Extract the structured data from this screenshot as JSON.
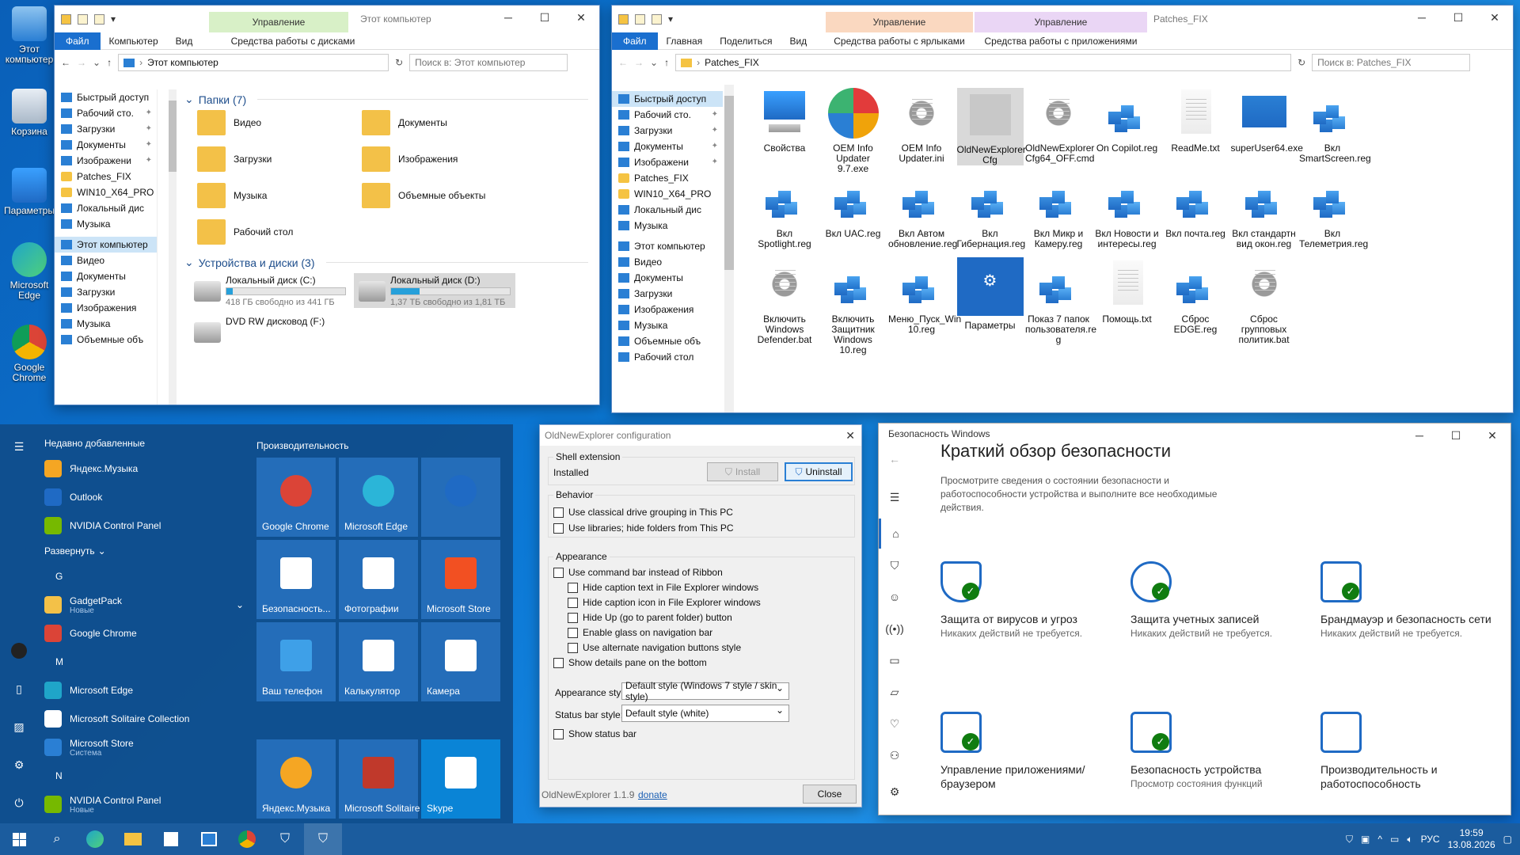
{
  "desktop": {
    "icons": [
      "Этот компьютер",
      "Корзина",
      "Параметры",
      "Microsoft Edge",
      "Google Chrome"
    ]
  },
  "explorer1": {
    "title": "Этот компьютер",
    "context_tab": "Управление",
    "ribbon": [
      "Файл",
      "Компьютер",
      "Вид",
      "Средства работы с дисками"
    ],
    "address": "Этот компьютер",
    "search_placeholder": "Поиск в: Этот компьютер",
    "nav": [
      {
        "label": "Быстрый доступ",
        "pin": false,
        "sel": false
      },
      {
        "label": "Рабочий сто.",
        "pin": true,
        "sel": false
      },
      {
        "label": "Загрузки",
        "pin": true,
        "sel": false
      },
      {
        "label": "Документы",
        "pin": true,
        "sel": false
      },
      {
        "label": "Изображени",
        "pin": true,
        "sel": false
      },
      {
        "label": "Patches_FIX",
        "pin": false,
        "sel": false
      },
      {
        "label": "WIN10_X64_PRO",
        "pin": false,
        "sel": false
      },
      {
        "label": "Локальный дис",
        "pin": false,
        "sel": false
      },
      {
        "label": "Музыка",
        "pin": false,
        "sel": false
      },
      {
        "label": "Этот компьютер",
        "pin": false,
        "sel": true
      },
      {
        "label": "Видео",
        "pin": false,
        "sel": false
      },
      {
        "label": "Документы",
        "pin": false,
        "sel": false
      },
      {
        "label": "Загрузки",
        "pin": false,
        "sel": false
      },
      {
        "label": "Изображения",
        "pin": false,
        "sel": false
      },
      {
        "label": "Музыка",
        "pin": false,
        "sel": false
      },
      {
        "label": "Объемные объ",
        "pin": false,
        "sel": false
      }
    ],
    "folders_header": "Папки (7)",
    "folders": [
      "Видео",
      "Документы",
      "Загрузки",
      "Изображения",
      "Музыка",
      "Объемные объекты",
      "Рабочий стол"
    ],
    "devices_header": "Устройства и диски (3)",
    "drives": [
      {
        "name": "Локальный диск (C:)",
        "free": "418 ГБ свободно из 441 ГБ",
        "used": 0.05
      },
      {
        "name": "Локальный диск (D:)",
        "free": "1,37 ТБ свободно из 1,81 ТБ",
        "used": 0.24
      },
      {
        "name": "DVD RW дисковод (F:)",
        "free": "",
        "used": 0
      }
    ]
  },
  "explorer2": {
    "title": "Patches_FIX",
    "context_tabs": [
      "Управление",
      "Управление"
    ],
    "ribbon": [
      "Файл",
      "Главная",
      "Поделиться",
      "Вид",
      "Средства работы с ярлыками",
      "Средства работы с приложениями"
    ],
    "address": "Patches_FIX",
    "search_placeholder": "Поиск в: Patches_FIX",
    "nav": [
      {
        "label": "Быстрый доступ",
        "pin": false,
        "sel": true
      },
      {
        "label": "Рабочий сто.",
        "pin": true,
        "sel": false
      },
      {
        "label": "Загрузки",
        "pin": true,
        "sel": false
      },
      {
        "label": "Документы",
        "pin": true,
        "sel": false
      },
      {
        "label": "Изображени",
        "pin": true,
        "sel": false
      },
      {
        "label": "Patches_FIX",
        "pin": false,
        "sel": false
      },
      {
        "label": "WIN10_X64_PRO",
        "pin": false,
        "sel": false
      },
      {
        "label": "Локальный дис",
        "pin": false,
        "sel": false
      },
      {
        "label": "Музыка",
        "pin": false,
        "sel": false
      },
      {
        "label": "Этот компьютер",
        "pin": false,
        "sel": false
      },
      {
        "label": "Видео",
        "pin": false,
        "sel": false
      },
      {
        "label": "Документы",
        "pin": false,
        "sel": false
      },
      {
        "label": "Загрузки",
        "pin": false,
        "sel": false
      },
      {
        "label": "Изображения",
        "pin": false,
        "sel": false
      },
      {
        "label": "Музыка",
        "pin": false,
        "sel": false
      },
      {
        "label": "Объемные объ",
        "pin": false,
        "sel": false
      },
      {
        "label": "Рабочий стол",
        "pin": false,
        "sel": false
      }
    ],
    "files": [
      {
        "label": "Свойства",
        "kind": "pc"
      },
      {
        "label": "OEM Info Updater 9.7.exe",
        "kind": "oem"
      },
      {
        "label": "OEM Info Updater.ini",
        "kind": "ini"
      },
      {
        "label": "OldNewExplorer Cfg",
        "kind": "shield"
      },
      {
        "label": "OldNewExplorer Cfg64_OFF.cmd",
        "kind": "cmd"
      },
      {
        "label": "On Copilot.reg",
        "kind": "reg"
      },
      {
        "label": "ReadMe.txt",
        "kind": "txt"
      },
      {
        "label": "superUser64.exe",
        "kind": "su"
      },
      {
        "label": "Вкл SmartScreen.reg",
        "kind": "reg"
      },
      {
        "label": "Вкл Spotlight.reg",
        "kind": "reg"
      },
      {
        "label": "Вкл UAC.reg",
        "kind": "reg"
      },
      {
        "label": "Вкл Автом обновление.reg",
        "kind": "reg"
      },
      {
        "label": "Вкл Гибернация.reg",
        "kind": "reg"
      },
      {
        "label": "Вкл Микр и Камеру.reg",
        "kind": "reg"
      },
      {
        "label": "Вкл Новости и интересы.reg",
        "kind": "reg"
      },
      {
        "label": "Вкл почта.reg",
        "kind": "reg"
      },
      {
        "label": "Вкл стандартн вид окон.reg",
        "kind": "reg"
      },
      {
        "label": "Вкл Телеметрия.reg",
        "kind": "reg"
      },
      {
        "label": "Включить Windows Defender.bat",
        "kind": "bat"
      },
      {
        "label": "Включить Защитник Windows 10.reg",
        "kind": "reg"
      },
      {
        "label": "Меню_Пуск_Win 10.reg",
        "kind": "reg"
      },
      {
        "label": "Параметры",
        "kind": "settings"
      },
      {
        "label": "Показ 7 папок пользователя.re g",
        "kind": "reg"
      },
      {
        "label": "Помощь.txt",
        "kind": "txt"
      },
      {
        "label": "Сброс EDGE.reg",
        "kind": "reg"
      },
      {
        "label": "Сброс групповых политик.bat",
        "kind": "bat"
      }
    ]
  },
  "start": {
    "recent_header": "Недавно добавленные",
    "productivity_header": "Производительность",
    "expand_label": "Развернуть",
    "list": [
      {
        "type": "app",
        "label": "Яндекс.Музыка",
        "sub": "",
        "color": "#f5a623"
      },
      {
        "type": "app",
        "label": "Outlook",
        "sub": "",
        "color": "#1f6ac4"
      },
      {
        "type": "app",
        "label": "NVIDIA Control Panel",
        "sub": "",
        "color": "#76b900"
      },
      {
        "type": "expand"
      },
      {
        "type": "letter",
        "label": "G"
      },
      {
        "type": "app",
        "label": "GadgetPack",
        "sub": "Новые",
        "color": "#f3c148"
      },
      {
        "type": "app",
        "label": "Google Chrome",
        "sub": "",
        "color": "#db4437"
      },
      {
        "type": "letter",
        "label": "M"
      },
      {
        "type": "app",
        "label": "Microsoft Edge",
        "sub": "",
        "color": "#1fa5c9"
      },
      {
        "type": "app",
        "label": "Microsoft Solitaire Collection",
        "sub": "",
        "color": "#ffffff"
      },
      {
        "type": "app",
        "label": "Microsoft Store",
        "sub": "Система",
        "color": "#2a7fd4"
      },
      {
        "type": "letter",
        "label": "N"
      },
      {
        "type": "app",
        "label": "NVIDIA Control Panel",
        "sub": "Новые",
        "color": "#76b900"
      }
    ],
    "tiles": [
      {
        "label": "Google Chrome",
        "color": "#db4437"
      },
      {
        "label": "Microsoft Edge",
        "color": "#2bb5d8"
      },
      {
        "label": "",
        "color": "#1f6ac4"
      },
      {
        "label": "Безопасность...",
        "color": "#ffffff"
      },
      {
        "label": "Фотографии",
        "color": "#ffffff"
      },
      {
        "label": "Microsoft Store",
        "color": "#f25022"
      },
      {
        "label": "Ваш телефон",
        "color": "#3ea0e8"
      },
      {
        "label": "Калькулятор",
        "color": "#ffffff"
      },
      {
        "label": "Камера",
        "color": "#ffffff"
      },
      {
        "label": "Яндекс.Музыка",
        "color": "#f5a623"
      },
      {
        "label": "Microsoft Solitaire Collection",
        "color": "#c0392b"
      },
      {
        "label": "Skype",
        "color": "#ffffff"
      }
    ]
  },
  "dialog": {
    "title": "OldNewExplorer configuration",
    "shell_group": "Shell extension",
    "status": "Installed",
    "install": "Install",
    "uninstall": "Uninstall",
    "behavior_group": "Behavior",
    "behavior": [
      "Use classical drive grouping in This PC",
      "Use libraries; hide folders from This PC"
    ],
    "appearance_group": "Appearance",
    "appearance": [
      {
        "label": "Use command bar instead of Ribbon",
        "indent": false
      },
      {
        "label": "Hide caption text in File Explorer windows",
        "indent": true
      },
      {
        "label": "Hide caption icon in File Explorer windows",
        "indent": true
      },
      {
        "label": "Hide Up (go to parent folder) button",
        "indent": true
      },
      {
        "label": "Enable glass on navigation bar",
        "indent": true
      },
      {
        "label": "Use alternate navigation buttons style",
        "indent": true
      },
      {
        "label": "Show details pane on the bottom",
        "indent": false
      }
    ],
    "appearance_style_label": "Appearance style:",
    "appearance_style_value": "Default style (Windows 7 style / skin style)",
    "status_bar_label": "Status bar style:",
    "status_bar_value": "Default style (white)",
    "show_status_bar": "Show status bar",
    "version": "OldNewExplorer 1.1.9",
    "donate": "donate",
    "close": "Close"
  },
  "security": {
    "title": "Безопасность Windows",
    "heading": "Краткий обзор безопасности",
    "desc": "Просмотрите сведения о состоянии безопасности и работоспособности устройства и выполните все необходимые действия.",
    "cards": [
      {
        "title": "Защита от вирусов и угроз",
        "sub": "Никаких действий не требуется.",
        "icon": "shield-icon"
      },
      {
        "title": "Защита учетных записей",
        "sub": "Никаких действий не требуется.",
        "icon": "account-icon"
      },
      {
        "title": "Брандмауэр и безопасность сети",
        "sub": "Никаких действий не требуется.",
        "icon": "antenna-icon"
      },
      {
        "title": "Управление приложениями/браузером",
        "sub": "",
        "icon": "app-browser-icon"
      },
      {
        "title": "Безопасность устройства",
        "sub": "Просмотр состояния функций",
        "icon": "laptop-icon"
      },
      {
        "title": "Производительность и работоспособность",
        "sub": "",
        "icon": "heart-icon"
      }
    ]
  },
  "tray": {
    "lang": "РУС",
    "time": "19:59",
    "date": "13.08.2026"
  }
}
